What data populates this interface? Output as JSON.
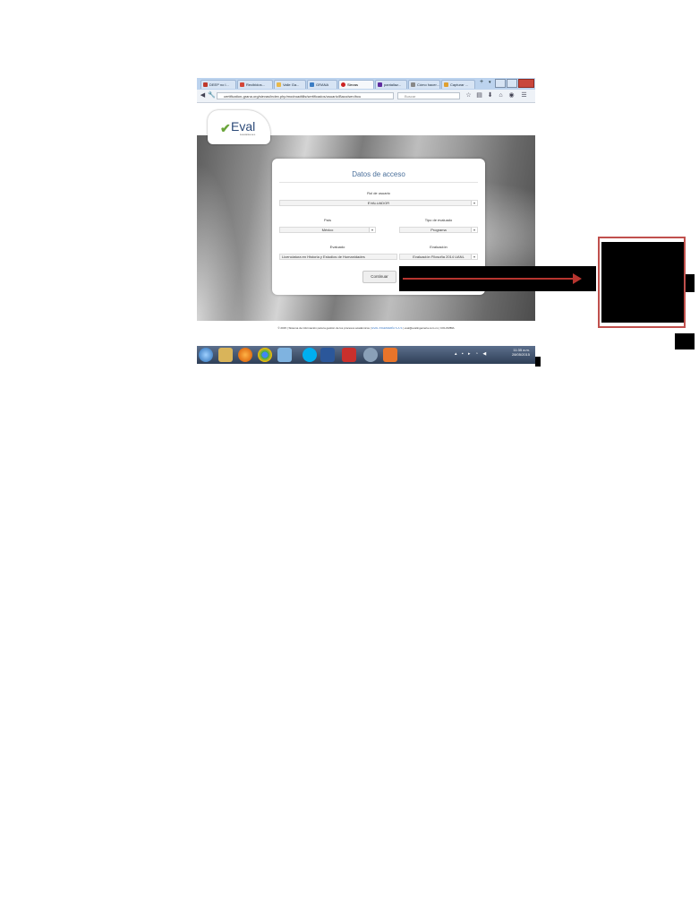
{
  "browser": {
    "tabs": [
      {
        "label": "DEEP no l...",
        "icon": "mail-icon",
        "color": "#c0392b"
      },
      {
        "label": "Recibidos...",
        "icon": "gmail-icon",
        "color": "#d44638"
      },
      {
        "label": "Valle Ga...",
        "icon": "folder-icon",
        "color": "#e8b84a"
      },
      {
        "label": "GRANA",
        "icon": "globe-icon",
        "color": "#3b7dc4"
      },
      {
        "label": "Sievas",
        "icon": "opera-icon",
        "color": "#cc2222",
        "active": true
      },
      {
        "label": "pantallaz...",
        "icon": "yahoo-icon",
        "color": "#5f2ca0"
      },
      {
        "label": "Cómo hacer...",
        "icon": "page-icon",
        "color": "#888888"
      },
      {
        "label": "Capturar ...",
        "icon": "image-icon",
        "color": "#e0a030"
      }
    ],
    "url": "certification-grana.org/sievas/index.php/modroadtills/sertificados/usuario/Baco/sen/bcu",
    "search_placeholder": "Buscar"
  },
  "page": {
    "logo_text": "Eval",
    "logo_sub": "INGENIERÍA S.A.S.",
    "card_title": "Datos de acceso",
    "fields": {
      "rol_label": "Rol de usuario",
      "rol_value": "EVALUADOR",
      "pais_label": "País",
      "pais_value": "México",
      "tipo_label": "Tipo de evaluado",
      "tipo_value": "Programa",
      "evaluado_label": "Evaluado",
      "evaluado_value": "Licenciatura en Historia y Estudios de Humanidades",
      "evaluacion_label": "Evaluación",
      "evaluacion_value": "Evaluación Filosofía 2014 UANL"
    },
    "continue_label": "Continuar",
    "footer_prefix": "© 2015 | Sistema de información para la gestión de los procesos académicos |",
    "footer_link": "EVAL INGENIERÍA S.A.S",
    "footer_suffix": "| eval@evalingenieria.com.co | COLOMBIA"
  },
  "taskbar": {
    "time": "11:35 a.m.",
    "date": "28/05/2015",
    "apps": [
      "start-orb",
      "explorer-icon",
      "firefox-icon",
      "chrome-icon",
      "folder-icon",
      "skype-icon",
      "word-icon",
      "pdf-icon",
      "media-icon",
      "paint-icon"
    ]
  }
}
